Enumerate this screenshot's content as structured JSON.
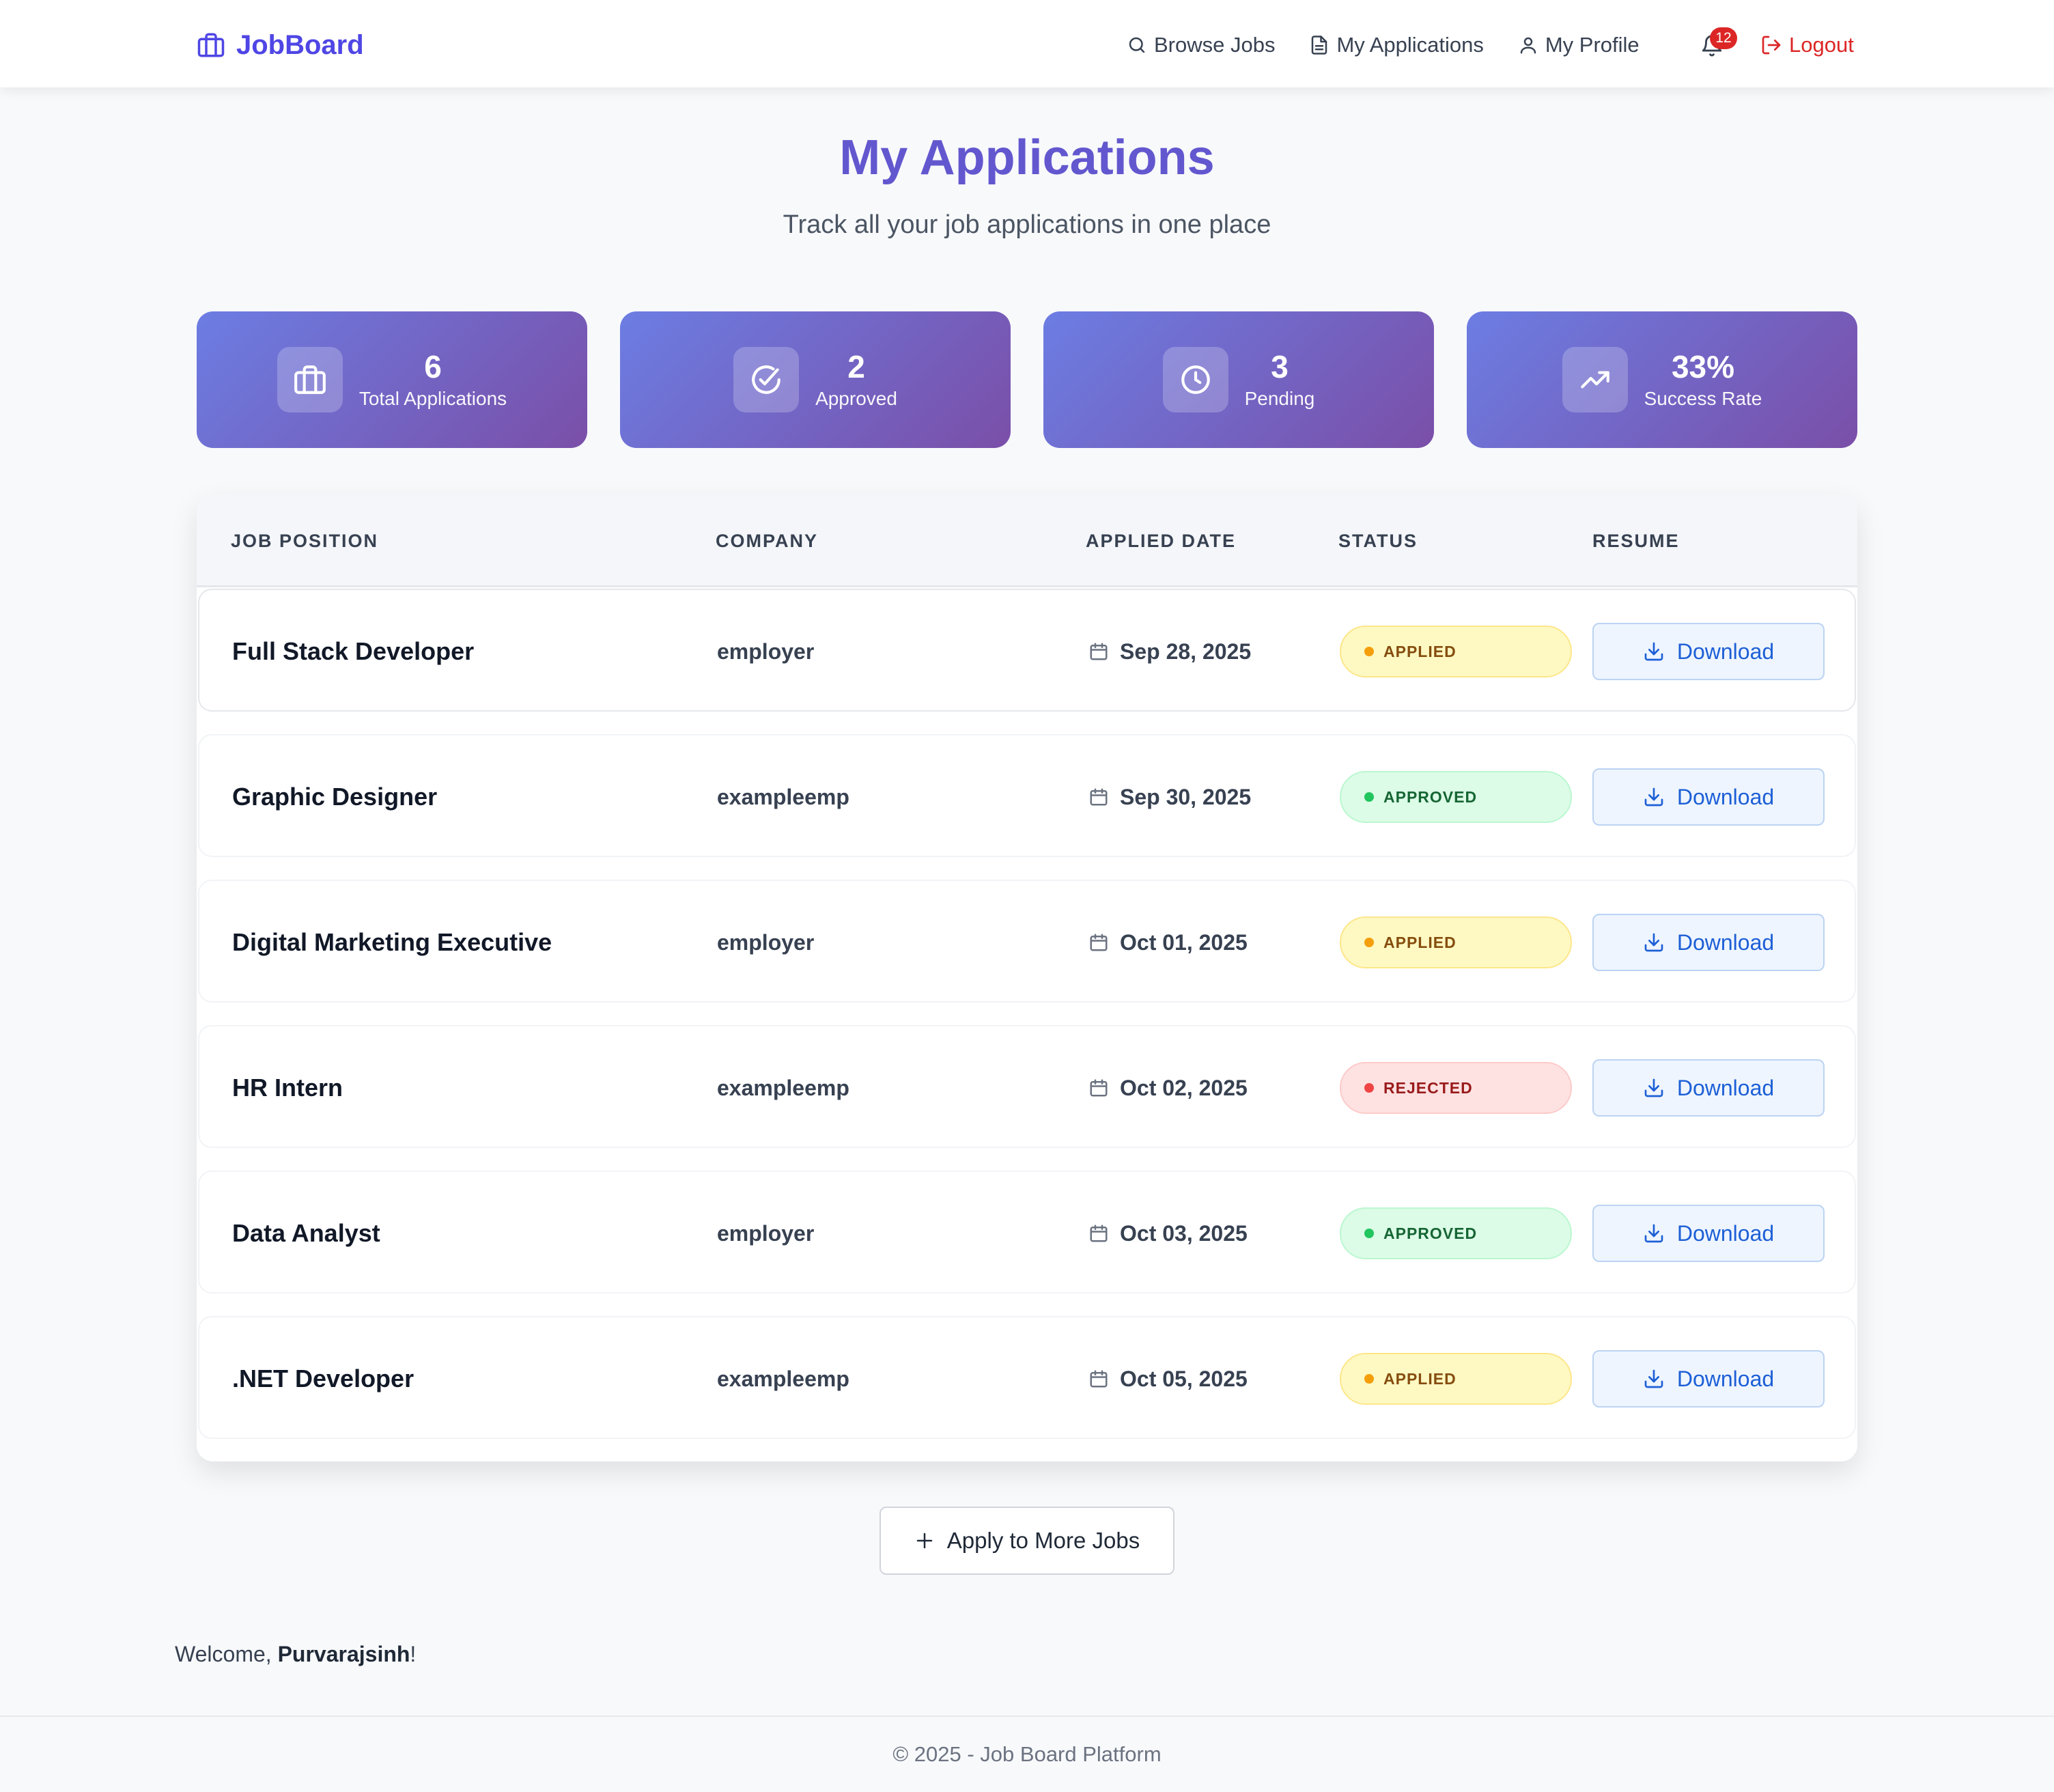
{
  "nav": {
    "brand": "JobBoard",
    "links": [
      {
        "label": "Browse Jobs",
        "icon": "search-icon"
      },
      {
        "label": "My Applications",
        "icon": "document-icon"
      },
      {
        "label": "My Profile",
        "icon": "user-icon"
      }
    ],
    "notification_count": "12",
    "logout_label": "Logout"
  },
  "header": {
    "title": "My Applications",
    "subtitle": "Track all your job applications in one place"
  },
  "stats": [
    {
      "value": "6",
      "label": "Total Applications",
      "icon": "briefcase-icon"
    },
    {
      "value": "2",
      "label": "Approved",
      "icon": "check-circle-icon"
    },
    {
      "value": "3",
      "label": "Pending",
      "icon": "clock-icon"
    },
    {
      "value": "33%",
      "label": "Success Rate",
      "icon": "trending-up-icon"
    }
  ],
  "table": {
    "columns": [
      "JOB POSITION",
      "COMPANY",
      "APPLIED DATE",
      "STATUS",
      "RESUME"
    ],
    "download_label": "Download",
    "rows": [
      {
        "position": "Full Stack Developer",
        "company": "employer",
        "date": "Sep 28, 2025",
        "status": "APPLIED"
      },
      {
        "position": "Graphic Designer",
        "company": "exampleemp",
        "date": "Sep 30, 2025",
        "status": "APPROVED"
      },
      {
        "position": "Digital Marketing Executive",
        "company": "employer",
        "date": "Oct 01, 2025",
        "status": "APPLIED"
      },
      {
        "position": "HR Intern",
        "company": "exampleemp",
        "date": "Oct 02, 2025",
        "status": "REJECTED"
      },
      {
        "position": "Data Analyst",
        "company": "employer",
        "date": "Oct 03, 2025",
        "status": "APPROVED"
      },
      {
        "position": ".NET Developer",
        "company": "exampleemp",
        "date": "Oct 05, 2025",
        "status": "APPLIED"
      }
    ]
  },
  "status_colors": {
    "APPLIED": {
      "bg": "#fef9c3",
      "border": "#fde68a",
      "text": "#854d0e",
      "dot": "#f59e0b"
    },
    "APPROVED": {
      "bg": "#dcfce7",
      "border": "#bbf7d0",
      "text": "#166534",
      "dot": "#22c55e"
    },
    "REJECTED": {
      "bg": "#fee2e2",
      "border": "#fecaca",
      "text": "#991b1b",
      "dot": "#ef4444"
    }
  },
  "apply_more_label": "Apply to More Jobs",
  "welcome": {
    "prefix": "Welcome, ",
    "name": "Purvarajsinh",
    "suffix": "!"
  },
  "footer": "© 2025 - Job Board Platform"
}
